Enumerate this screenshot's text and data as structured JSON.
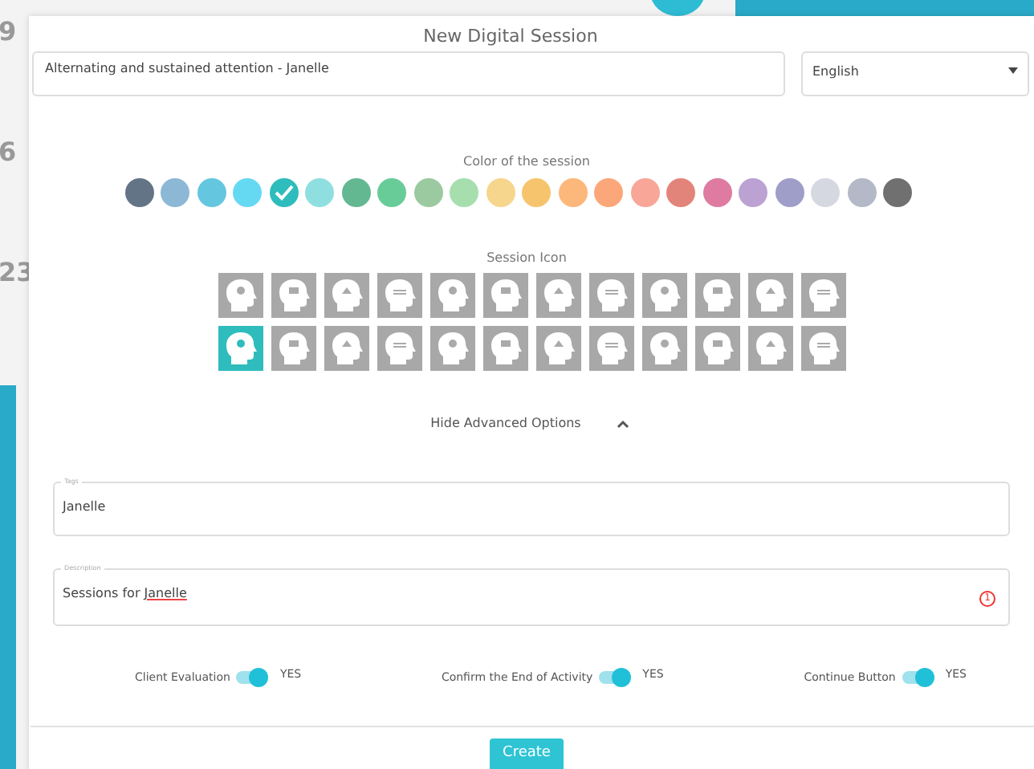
{
  "background": {
    "calendar_days": [
      "9",
      "6",
      "23"
    ]
  },
  "dialog": {
    "title": "New Digital Session",
    "name_field": {
      "value": "Alternating and sustained attention - Janelle"
    },
    "language_select": {
      "value": "English"
    },
    "color_section": {
      "label": "Color of the session",
      "colors": [
        {
          "color": "#647487",
          "selected": false
        },
        {
          "color": "#8cb8d6",
          "selected": false
        },
        {
          "color": "#65c6e0",
          "selected": false
        },
        {
          "color": "#66d9f2",
          "selected": false
        },
        {
          "color": "#2ebcbc",
          "selected": true
        },
        {
          "color": "#8fdfe0",
          "selected": false
        },
        {
          "color": "#63b891",
          "selected": false
        },
        {
          "color": "#68cc99",
          "selected": false
        },
        {
          "color": "#9ccaa0",
          "selected": false
        },
        {
          "color": "#a6dfad",
          "selected": false
        },
        {
          "color": "#f6d68c",
          "selected": false
        },
        {
          "color": "#f6c46d",
          "selected": false
        },
        {
          "color": "#fcb77b",
          "selected": false
        },
        {
          "color": "#fca77a",
          "selected": false
        },
        {
          "color": "#f8a698",
          "selected": false
        },
        {
          "color": "#e3847b",
          "selected": false
        },
        {
          "color": "#df7aa0",
          "selected": false
        },
        {
          "color": "#bca2d3",
          "selected": false
        },
        {
          "color": "#9e9ec9",
          "selected": false
        },
        {
          "color": "#d6d8e1",
          "selected": false
        },
        {
          "color": "#b3b9c7",
          "selected": false
        },
        {
          "color": "#707070",
          "selected": false
        }
      ]
    },
    "icon_section": {
      "label": "Session Icon",
      "icons": [
        {
          "selected": false
        },
        {
          "selected": false
        },
        {
          "selected": false
        },
        {
          "selected": false
        },
        {
          "selected": false
        },
        {
          "selected": false
        },
        {
          "selected": false
        },
        {
          "selected": false
        },
        {
          "selected": false
        },
        {
          "selected": false
        },
        {
          "selected": false
        },
        {
          "selected": false
        },
        {
          "selected": true
        },
        {
          "selected": false
        },
        {
          "selected": false
        },
        {
          "selected": false
        },
        {
          "selected": false
        },
        {
          "selected": false
        },
        {
          "selected": false
        },
        {
          "selected": false
        },
        {
          "selected": false
        },
        {
          "selected": false
        },
        {
          "selected": false
        },
        {
          "selected": false
        }
      ]
    },
    "advanced_toggle": {
      "label": "Hide Advanced Options",
      "expanded": true
    },
    "tags_field": {
      "label": "Tags",
      "value": "Janelle"
    },
    "description_field": {
      "label": "Description",
      "value_prefix": "Sessions for ",
      "value_misspelled": "Janelle",
      "error_count": "1"
    },
    "toggles": [
      {
        "label": "Client Evaluation",
        "on": true,
        "state_text": "YES"
      },
      {
        "label": "Confirm the End of Activity",
        "on": true,
        "state_text": "YES"
      },
      {
        "label": "Continue Button",
        "on": true,
        "state_text": "YES"
      }
    ],
    "create_button": "Create"
  }
}
